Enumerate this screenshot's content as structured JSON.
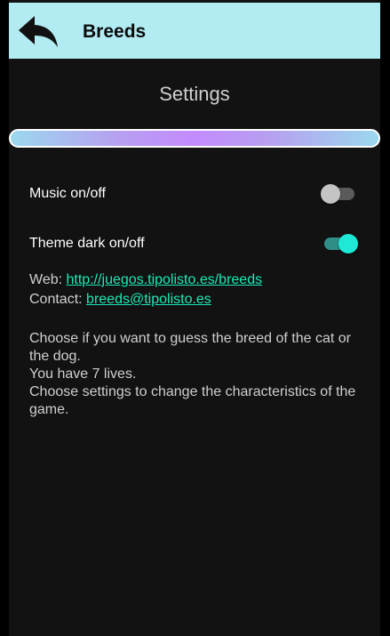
{
  "appbar": {
    "title": "Breeds",
    "back_icon": "back-arrow-icon"
  },
  "settings_title": "Settings",
  "toggles": {
    "music": {
      "label": "Music on/off",
      "on": false
    },
    "theme": {
      "label": "Theme dark on/off",
      "on": true
    }
  },
  "web": {
    "label": "Web:",
    "link": "http://juegos.tipolisto.es/breeds"
  },
  "contact": {
    "label": "Contact:",
    "link": "breeds@tipolisto.es"
  },
  "description": [
    "Choose if you want to guess the breed of the cat or the dog.",
    "You have 7 lives.",
    "Choose settings to change the characteristics of the game."
  ],
  "colors": {
    "appbar_bg": "#b2ebf2",
    "background": "#121212",
    "accent": "#1de9b6",
    "link": "#1de9b6",
    "gradient_center": "#c38bff",
    "gradient_edge": "#9bd8ee"
  }
}
